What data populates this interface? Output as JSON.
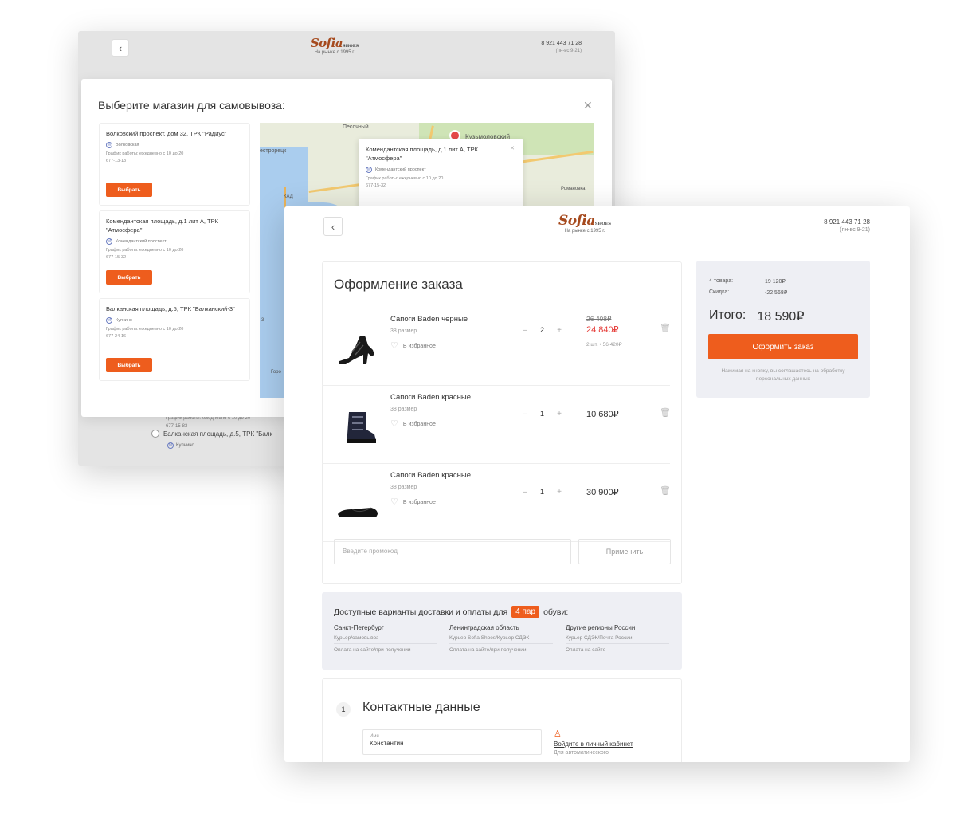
{
  "colors": {
    "accent": "#ee5d1d",
    "brand": "#a64a1e",
    "sale": "#e53935",
    "panel_bg": "#eeeff4"
  },
  "header": {
    "logo_brand": "Sofia",
    "logo_suffix": "SHOES",
    "logo_sub": "На рынке с 1995 г.",
    "phone": "8 921 443 71 28",
    "hours": "(пн-вс 9-21)",
    "back_icon": "chevron-left-icon"
  },
  "modal": {
    "title": "Выберите магазин для самовывоза:",
    "stores": [
      {
        "address": "Волковский проспект, дом 32, ТРК \"Радиус\"",
        "metro": "Волковская",
        "hours": "График работы: ежедневно с 10 до 20",
        "phone": "677-13-13",
        "button": "Выбрать"
      },
      {
        "address": "Комендантская площадь, д.1 лит А, ТРК \"Атмосфера\"",
        "metro": "Комендантский проспект",
        "hours": "График работы: ежедневно с 10 до 20",
        "phone": "677-15-32",
        "button": "Выбрать"
      },
      {
        "address": "Балканская площадь, д.5, ТРК \"Балканский-3\"",
        "metro": "Купчино",
        "hours": "График работы: ежедневно с 10 до 20",
        "phone": "677-24-16",
        "button": "Выбрать"
      }
    ],
    "map_labels": [
      "Песочный",
      "Кузьмоловский",
      "естрорецк",
      "Романовка",
      "Горо",
      "КАД",
      "3"
    ],
    "popup": {
      "address": "Комендантская площадь, д.1 лит А, ТРК \"Атмосфера\"",
      "metro": "Комендантский проспект",
      "hours": "График работы: ежедневно с 10 до 20",
      "phone": "677-15-32"
    }
  },
  "behind": {
    "hours_line": "График работы: ежедневно с 10 до 20",
    "phone_line": "677-15-83",
    "address": "Балканская площадь, д.5, ТРК \"Балк",
    "metro": "Купчино"
  },
  "order": {
    "title": "Оформление заказа",
    "items": [
      {
        "name": "Сапоги Baden черные",
        "size": "38 размер",
        "fav": "В избранное",
        "qty": "2",
        "price_old": "26 408₽",
        "price": "24 840₽",
        "note": "2 шт. • 56 420₽"
      },
      {
        "name": "Сапоги Baden красные",
        "size": "38 размер",
        "fav": "В избранное",
        "qty": "1",
        "price": "10 680₽"
      },
      {
        "name": "Сапоги Baden красные",
        "size": "38 размер",
        "fav": "В избранное",
        "qty": "1",
        "price": "30 900₽"
      }
    ],
    "promo_placeholder": "Введите промокод",
    "apply": "Применить"
  },
  "delivery": {
    "head_before": "Доступные варианты доставки и оплаты для",
    "badge": "4 пар",
    "head_after": "обуви:",
    "columns": [
      {
        "region": "Санкт-Петербург",
        "method": "Курьер/самовывоз",
        "payment": "Оплата на сайте/при получении"
      },
      {
        "region": "Ленинградская область",
        "method": "Курьер Sofia Shoes/Курьер СДЭК",
        "payment": "Оплата на сайте/при получении"
      },
      {
        "region": "Другие регионы России",
        "method": "Курьер СДЭК/Почта России",
        "payment": "Оплата на сайте"
      }
    ]
  },
  "contact": {
    "step": "1",
    "title": "Контактные данные",
    "name_label": "Имя",
    "name_value": "Константин",
    "login_link": "Войдите в личный кабинет",
    "login_sub": "Для автоматического"
  },
  "summary": {
    "items_label": "4 товара:",
    "items_value": "19 120₽",
    "discount_label": "Скидка:",
    "discount_value": "-22 568₽",
    "total_label": "Итого:",
    "total_value": "18 590₽",
    "button": "Оформить заказ",
    "consent": "Нажимая на кнопку, вы соглашаетесь на обработку персональных данных"
  }
}
